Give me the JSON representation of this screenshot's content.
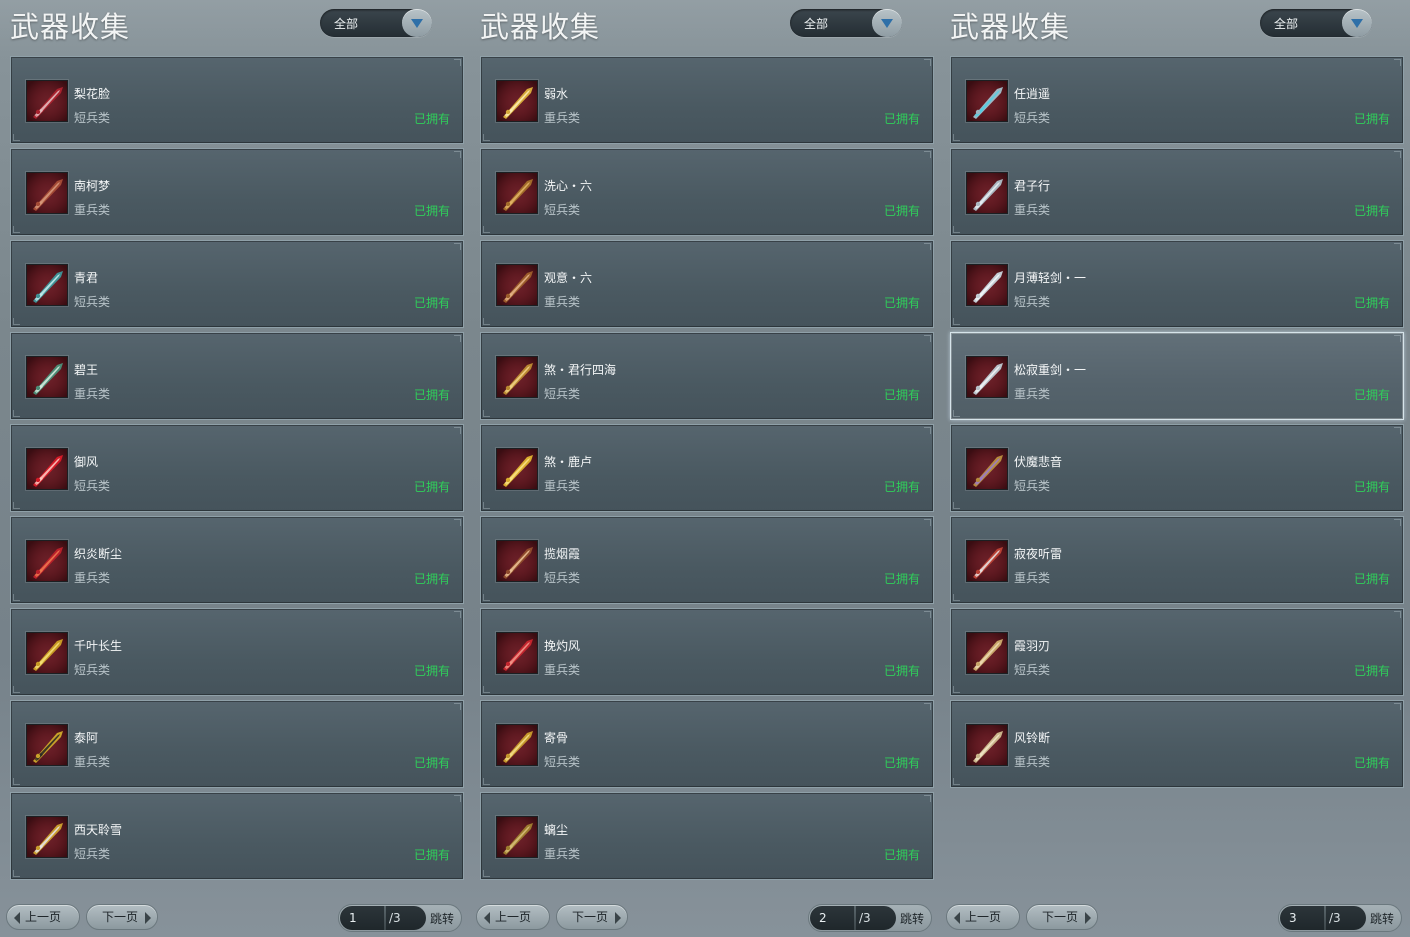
{
  "panels": [
    {
      "title": "武器收集",
      "filter": "全部",
      "items": [
        {
          "name": "梨花脸",
          "type": "短兵类",
          "status": "已拥有",
          "icon": "crimson-blade-icon"
        },
        {
          "name": "南柯梦",
          "type": "重兵类",
          "status": "已拥有",
          "icon": "red-broad-blade-icon"
        },
        {
          "name": "青君",
          "type": "短兵类",
          "status": "已拥有",
          "icon": "teal-sword-icon"
        },
        {
          "name": "碧王",
          "type": "重兵类",
          "status": "已拥有",
          "icon": "jade-blade-icon"
        },
        {
          "name": "御风",
          "type": "短兵类",
          "status": "已拥有",
          "icon": "red-spark-blade-icon"
        },
        {
          "name": "织炎断尘",
          "type": "重兵类",
          "status": "已拥有",
          "icon": "flame-blade-icon"
        },
        {
          "name": "千叶长生",
          "type": "短兵类",
          "status": "已拥有",
          "icon": "gold-staff-icon"
        },
        {
          "name": "泰阿",
          "type": "重兵类",
          "status": "已拥有",
          "icon": "gold-black-blade-icon"
        },
        {
          "name": "西天聆雪",
          "type": "短兵类",
          "status": "已拥有",
          "icon": "gold-trident-icon"
        }
      ],
      "pager": {
        "prev": "上一页",
        "next": "下一页",
        "current": "1",
        "total": "/3",
        "jump": "跳转"
      }
    },
    {
      "title": "武器收集",
      "filter": "全部",
      "items": [
        {
          "name": "弱水",
          "type": "重兵类",
          "status": "已拥有",
          "icon": "gold-greatsword-icon"
        },
        {
          "name": "洗心・六",
          "type": "短兵类",
          "status": "已拥有",
          "icon": "bronze-dagger-icon"
        },
        {
          "name": "观意・六",
          "type": "重兵类",
          "status": "已拥有",
          "icon": "bronze-blade-icon"
        },
        {
          "name": "煞・君行四海",
          "type": "短兵类",
          "status": "已拥有",
          "icon": "ornate-gold-blade-icon"
        },
        {
          "name": "煞・鹿卢",
          "type": "重兵类",
          "status": "已拥有",
          "icon": "twin-gold-blade-icon"
        },
        {
          "name": "揽烟霞",
          "type": "短兵类",
          "status": "已拥有",
          "icon": "spiked-sword-icon"
        },
        {
          "name": "挽灼风",
          "type": "重兵类",
          "status": "已拥有",
          "icon": "crimson-greatsword-icon"
        },
        {
          "name": "寄骨",
          "type": "短兵类",
          "status": "已拥有",
          "icon": "gold-cross-sword-icon"
        },
        {
          "name": "螭尘",
          "type": "重兵类",
          "status": "已拥有",
          "icon": "dragon-blade-icon"
        }
      ],
      "pager": {
        "prev": "上一页",
        "next": "下一页",
        "current": "2",
        "total": "/3",
        "jump": "跳转"
      }
    },
    {
      "title": "武器收集",
      "filter": "全部",
      "items": [
        {
          "name": "任逍遥",
          "type": "短兵类",
          "status": "已拥有",
          "icon": "silver-spear-icon"
        },
        {
          "name": "君子行",
          "type": "重兵类",
          "status": "已拥有",
          "icon": "silver-greatsword-icon"
        },
        {
          "name": "月薄轻剑・一",
          "type": "短兵类",
          "status": "已拥有",
          "icon": "light-sword-icon"
        },
        {
          "name": "松寂重剑・一",
          "type": "重兵类",
          "status": "已拥有",
          "icon": "heavy-sword-icon",
          "selected": true
        },
        {
          "name": "伏魔悲音",
          "type": "短兵类",
          "status": "已拥有",
          "icon": "purple-gold-sword-icon"
        },
        {
          "name": "寂夜听雷",
          "type": "重兵类",
          "status": "已拥有",
          "icon": "red-silver-blade-icon"
        },
        {
          "name": "霞羽刃",
          "type": "短兵类",
          "status": "已拥有",
          "icon": "feather-blade-icon"
        },
        {
          "name": "风铃断",
          "type": "重兵类",
          "status": "已拥有",
          "icon": "bone-blade-icon"
        }
      ],
      "pager": {
        "prev": "上一页",
        "next": "下一页",
        "current": "3",
        "total": "/3",
        "jump": "跳转"
      }
    }
  ],
  "icon_palettes": {
    "crimson-blade-icon": [
      "#3a0d12",
      "#a8222e",
      "#e6c3c6"
    ],
    "red-broad-blade-icon": [
      "#2a1410",
      "#a34a35",
      "#d99b7e"
    ],
    "teal-sword-icon": [
      "#0f2a2c",
      "#3f8f93",
      "#c9eef0"
    ],
    "jade-blade-icon": [
      "#0f2622",
      "#4c8a74",
      "#d9efe3"
    ],
    "red-spark-blade-icon": [
      "#300508",
      "#d41a26",
      "#ffd0c8"
    ],
    "flame-blade-icon": [
      "#2b0606",
      "#b8202a",
      "#f07a50"
    ],
    "gold-staff-icon": [
      "#1e1604",
      "#c79a24",
      "#f7e27a"
    ],
    "gold-black-blade-icon": [
      "#141008",
      "#c9a22a",
      "#232323"
    ],
    "gold-trident-icon": [
      "#161207",
      "#c89b2c",
      "#e8e8f0"
    ],
    "gold-greatsword-icon": [
      "#1c1507",
      "#d6a93a",
      "#fff1b8"
    ],
    "bronze-dagger-icon": [
      "#1e1306",
      "#a26b2a",
      "#e5b668"
    ],
    "bronze-blade-icon": [
      "#201207",
      "#9a5b2a",
      "#e7b58a"
    ],
    "ornate-gold-blade-icon": [
      "#1a1207",
      "#b88630",
      "#f2d488"
    ],
    "twin-gold-blade-icon": [
      "#1b1406",
      "#d9ac2e",
      "#fbe58a"
    ],
    "spiked-sword-icon": [
      "#1c120c",
      "#8e4a2c",
      "#f0c69a"
    ],
    "crimson-greatsword-icon": [
      "#2b0608",
      "#c3252e",
      "#f39a8c"
    ],
    "gold-cross-sword-icon": [
      "#1c1505",
      "#c3962b",
      "#f5df8a"
    ],
    "dragon-blade-icon": [
      "#1a1407",
      "#9c7a2e",
      "#d8c07a"
    ],
    "silver-spear-icon": [
      "#0d1418",
      "#9fb6c2",
      "#4fd0e6"
    ],
    "silver-greatsword-icon": [
      "#101417",
      "#aab6bf",
      "#e9f1f5"
    ],
    "light-sword-icon": [
      "#111417",
      "#c2ccd3",
      "#f6f9fb"
    ],
    "heavy-sword-icon": [
      "#121416",
      "#b8c1c8",
      "#f2f5f7"
    ],
    "purple-gold-sword-icon": [
      "#1b1322",
      "#b58a3c",
      "#9a7ad0"
    ],
    "red-silver-blade-icon": [
      "#1d0d0c",
      "#b84034",
      "#e8e8ea"
    ],
    "feather-blade-icon": [
      "#1a1508",
      "#c8a56a",
      "#eedcb5"
    ],
    "bone-blade-icon": [
      "#18140d",
      "#c9b48a",
      "#f2e6c8"
    ]
  }
}
